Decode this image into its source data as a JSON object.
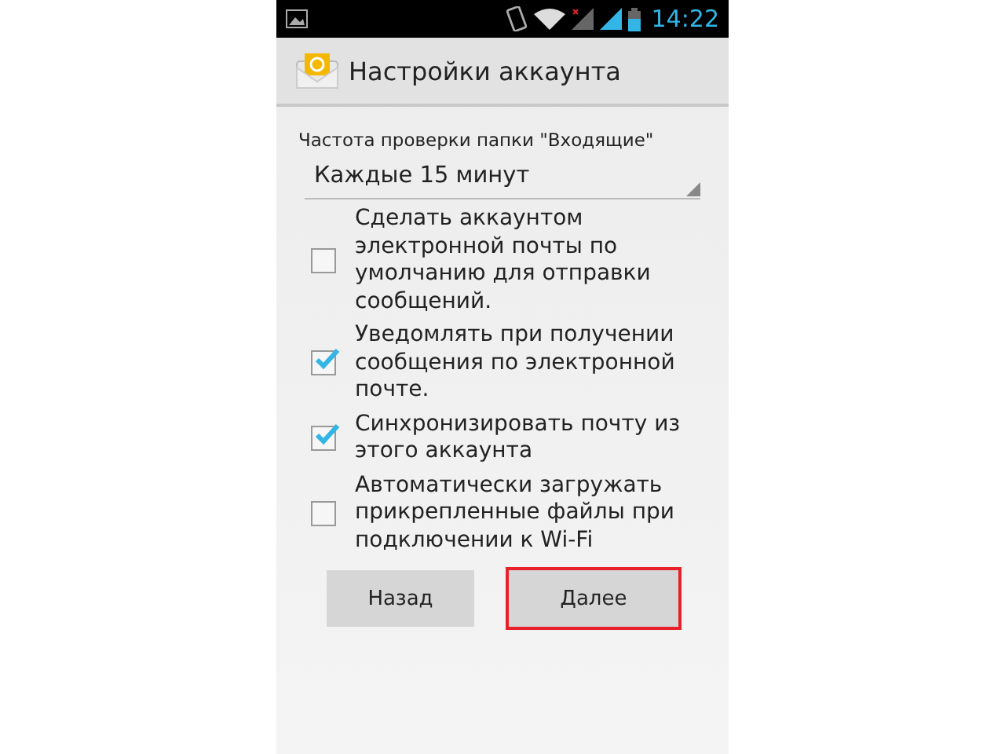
{
  "status_bar": {
    "time": "14:22"
  },
  "action_bar": {
    "title": "Настройки аккаунта"
  },
  "check_frequency": {
    "label": "Частота проверки папки \"Входящие\"",
    "value": "Каждые 15 минут"
  },
  "options": [
    {
      "label": "Сделать аккаунтом электронной почты по умолчанию для отправки сообщений.",
      "checked": false
    },
    {
      "label": "Уведомлять при получении сообщения по электронной почте.",
      "checked": true
    },
    {
      "label": "Синхронизировать почту из этого аккаунта",
      "checked": true
    },
    {
      "label": "Автоматически загружать прикрепленные файлы при подключении к Wi-Fi",
      "checked": false
    }
  ],
  "buttons": [
    {
      "label": "Назад",
      "highlighted": false
    },
    {
      "label": "Далее",
      "highlighted": true
    }
  ]
}
